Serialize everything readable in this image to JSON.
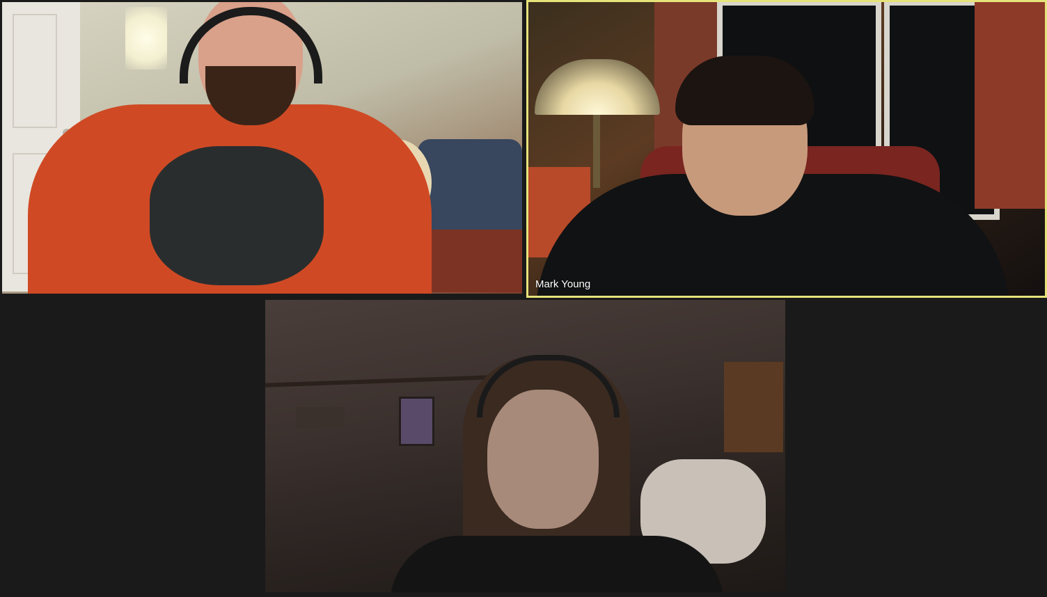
{
  "participants": [
    {
      "id": "participant-1",
      "name": "",
      "active_speaker": false
    },
    {
      "id": "participant-2",
      "name": "Mark Young",
      "active_speaker": true
    },
    {
      "id": "participant-3",
      "name": "",
      "active_speaker": false
    }
  ],
  "colors": {
    "background": "#1a1a1a",
    "active_speaker_border": "#e6e37a",
    "name_label_text": "#ffffff"
  }
}
